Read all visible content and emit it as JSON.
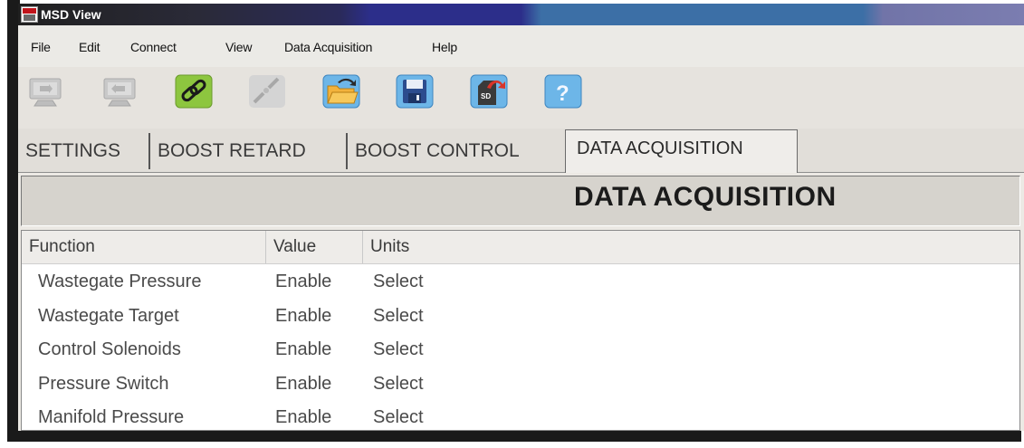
{
  "window": {
    "title": "MSD View"
  },
  "menu": [
    "File",
    "Edit",
    "Connect",
    "View",
    "Data Acquisition",
    "Help"
  ],
  "toolbar": {
    "buttons": [
      {
        "icon": "read-from-device-icon",
        "enabled": false
      },
      {
        "icon": "write-to-device-icon",
        "enabled": false
      },
      {
        "icon": "connect-link-icon",
        "enabled": true
      },
      {
        "icon": "disconnect-icon",
        "enabled": false
      },
      {
        "icon": "open-folder-icon",
        "enabled": true
      },
      {
        "icon": "save-floppy-icon",
        "enabled": true
      },
      {
        "icon": "sd-card-icon",
        "enabled": true
      },
      {
        "icon": "help-icon",
        "enabled": true
      }
    ]
  },
  "tabs": [
    "SETTINGS",
    "BOOST RETARD",
    "BOOST CONTROL",
    "DATA ACQUISITION"
  ],
  "active_tab": "DATA ACQUISITION",
  "page_title": "DATA ACQUISITION",
  "table": {
    "columns": [
      "Function",
      "Value",
      "Units"
    ],
    "rows": [
      [
        "Wastegate Pressure",
        "Enable",
        "Select"
      ],
      [
        "Wastegate Target",
        "Enable",
        "Select"
      ],
      [
        "Control Solenoids",
        "Enable",
        "Select"
      ],
      [
        "Pressure Switch",
        "Enable",
        "Select"
      ],
      [
        "Manifold Pressure",
        "Enable",
        "Select"
      ]
    ]
  }
}
